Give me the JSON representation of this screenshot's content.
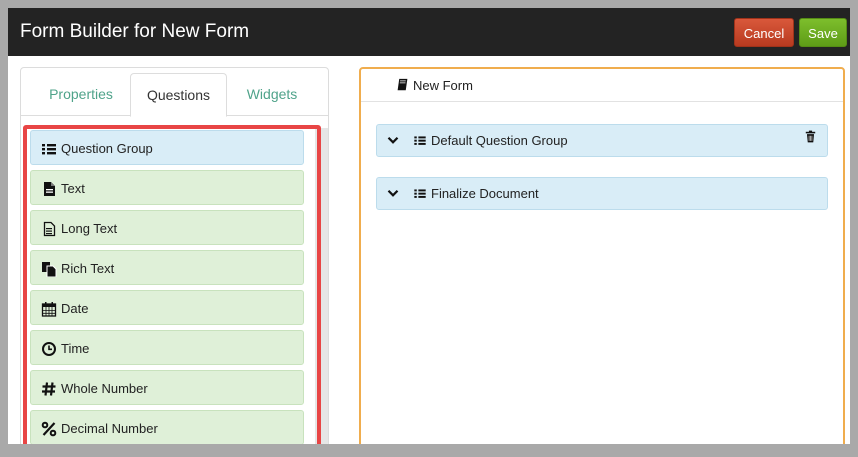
{
  "header": {
    "title": "Form Builder for New Form",
    "cancel_label": "Cancel",
    "save_label": "Save"
  },
  "tabs": [
    {
      "label": "Properties",
      "active": false
    },
    {
      "label": "Questions",
      "active": true
    },
    {
      "label": "Widgets",
      "active": false
    }
  ],
  "question_types": [
    {
      "label": "Question Group",
      "icon": "list-icon"
    },
    {
      "label": "Text",
      "icon": "document-icon"
    },
    {
      "label": "Long Text",
      "icon": "document-outline-icon"
    },
    {
      "label": "Rich Text",
      "icon": "copy-icon"
    },
    {
      "label": "Date",
      "icon": "calendar-icon"
    },
    {
      "label": "Time",
      "icon": "clock-icon"
    },
    {
      "label": "Whole Number",
      "icon": "hash-icon"
    },
    {
      "label": "Decimal Number",
      "icon": "percent-icon"
    }
  ],
  "form": {
    "title": "New Form",
    "title_icon": "book-icon",
    "groups": [
      {
        "label": "Default Question Group",
        "deletable": true
      },
      {
        "label": "Finalize Document",
        "deletable": false
      }
    ]
  },
  "colors": {
    "topbar": "#232323",
    "cancel": "#c9472b",
    "save": "#6cac22",
    "tab_link": "#4fa38a",
    "question_item": "#dff0d8",
    "group_item": "#d9edf7",
    "highlight": "#e84545",
    "form_border": "#f0ad4e"
  }
}
